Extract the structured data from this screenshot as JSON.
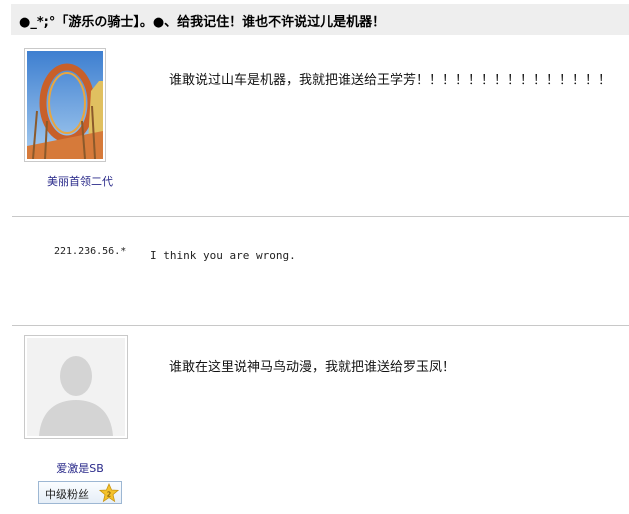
{
  "thread": {
    "title": "●_*;°「游乐の骑士】。●、给我记住！谁也不许说过儿是机器！"
  },
  "posts": [
    {
      "username": "美丽首领二代",
      "avatar": "roller-coaster-avatar",
      "content": "谁敢说过山车是机器，我就把谁送给王学芳！！！！！！！！！！！！！！！"
    },
    {
      "ip": "221.236.56.*",
      "content": "I think you are wrong."
    },
    {
      "username": "爱激是SB",
      "avatar": "default-silhouette-avatar",
      "content": "谁敢在这里说神马鸟动漫，我就把谁送给罗玉凤！",
      "badge": {
        "label": "中级粉丝",
        "level": "2"
      }
    }
  ],
  "colors": {
    "title_bg": "#eeeeee",
    "username": "#2a2a8a",
    "divider": "#c8c8c8",
    "badge_border": "#9db7d3",
    "star": "#f4c22b"
  }
}
